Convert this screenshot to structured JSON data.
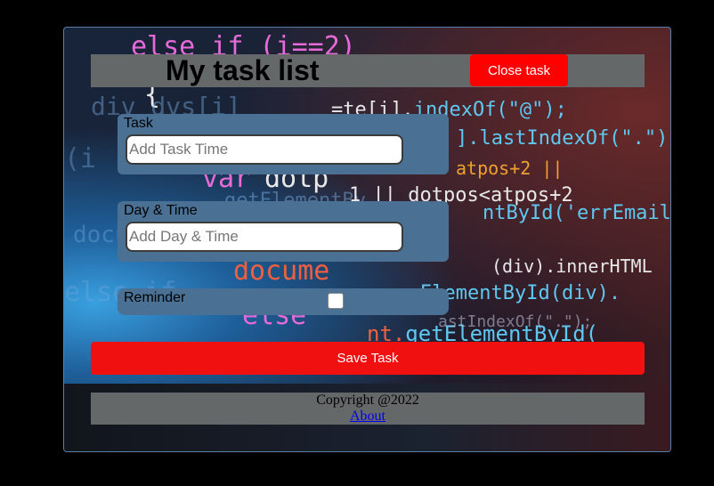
{
  "header": {
    "title": "My task list",
    "close_label": "Close task"
  },
  "form": {
    "task": {
      "label": "Task",
      "placeholder": "Add Task Time",
      "value": ""
    },
    "day_time": {
      "label": "Day & Time",
      "placeholder": "Add Day & Time",
      "value": ""
    },
    "reminder": {
      "label": "Reminder",
      "checked": false
    },
    "save_label": "Save Task"
  },
  "footer": {
    "copyright": "Copyright @2022",
    "about_link": "About"
  },
  "colors": {
    "accent_red": "#ff0000",
    "header_bg": "#646869",
    "field_bg": "#4a7093"
  }
}
